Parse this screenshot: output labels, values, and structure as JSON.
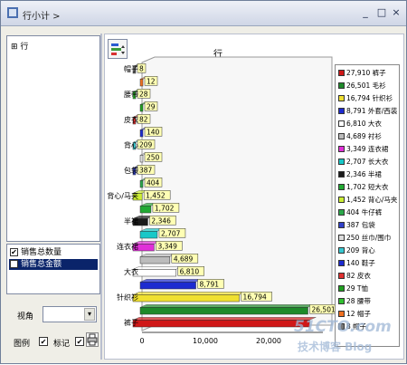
{
  "window": {
    "title": "行小计 >",
    "min_label": "_",
    "max_label": "□",
    "close_label": "×"
  },
  "tree": {
    "root_label": "⊞ 行"
  },
  "measures": [
    {
      "label": "销售总数量",
      "checked": true,
      "selected": false
    },
    {
      "label": "销售总金额",
      "checked": false,
      "selected": true
    }
  ],
  "controls": {
    "view_label": "视角",
    "view_value": "",
    "legend_label": "图例",
    "legend_checked": true,
    "marker_label": "标记",
    "marker_checked": true
  },
  "chart_data": {
    "type": "bar",
    "orientation": "horizontal",
    "title": "行",
    "categories": [
      "裤子",
      "毛衫",
      "针织衫",
      "外套/西装",
      "大衣",
      "衬衫",
      "连衣裙",
      "长大衣",
      "半裙",
      "短大衣",
      "背心/马夹",
      "牛仔裤",
      "包袋",
      "丝巾/围巾",
      "背心",
      "鞋子",
      "皮衣",
      "T恤",
      "腰带",
      "帽子"
    ],
    "y_tick_labels": [
      "裤子",
      "针织衫",
      "大衣",
      "连衣裙",
      "半裙",
      "背心/马夹",
      "包袋",
      "背心",
      "皮衣",
      "腰带",
      "帽子"
    ],
    "values": [
      27910,
      26501,
      16794,
      8791,
      6810,
      4689,
      3349,
      2707,
      2346,
      1702,
      1452,
      404,
      387,
      250,
      209,
      140,
      82,
      29,
      28,
      12,
      8
    ],
    "value_labels": [
      "",
      "26,501",
      "16,794",
      "8,791",
      "6,810",
      "4,689",
      "3,349",
      "2,707",
      "2,346",
      "1,702",
      "1,452",
      "404",
      "387",
      "250",
      "209",
      "140",
      "82",
      "29",
      "28",
      "12",
      "8"
    ],
    "xlim": [
      0,
      30000
    ],
    "x_ticks": [
      "0",
      "10,000",
      "20,000"
    ],
    "legend_placement": "right",
    "legend": [
      "27,910 裤子",
      "26,501 毛衫",
      "16,794 针织衫",
      "8,791 外套/西装",
      "6,810 大衣",
      "4,689 衬衫",
      "3,349 连衣裙",
      "2,707 长大衣",
      "2,346 半裙",
      "1,702 短大衣",
      "1,452 背心/马夹",
      "404 牛仔裤",
      "387 包袋",
      "250 丝巾/围巾",
      "209 背心",
      "140 鞋子",
      "82 皮衣",
      "29 T恤",
      "28 腰带",
      "12 帽子",
      "8 帽子"
    ],
    "colors": [
      "#d01818",
      "#1e8a2a",
      "#f0e030",
      "#1d2bd0",
      "#ffffff",
      "#bcbcbc",
      "#e030d8",
      "#18c8c8",
      "#1a1a1a",
      "#22aa33",
      "#ccee33",
      "#2aa84a",
      "#3040c8",
      "#dddddd",
      "#38c8d0",
      "#1d2bd0",
      "#e03030",
      "#20a020",
      "#30c030",
      "#f07020",
      "#777777"
    ]
  },
  "watermark": {
    "line1": "51CTO.com",
    "line2": "技术博客 Blog"
  }
}
